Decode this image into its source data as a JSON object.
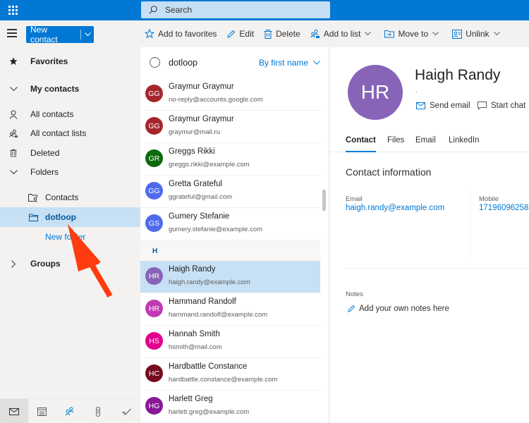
{
  "topbar": {
    "app_launcher_icon": "waffle-icon",
    "search_placeholder": "Search",
    "theme_color": "#0078d4",
    "search_bg": "#c7dff5"
  },
  "commandbar": {
    "new_contact_label": "New contact",
    "actions": [
      {
        "label": "Add to favorites",
        "icon": "star-add-icon",
        "has_dropdown": false
      },
      {
        "label": "Edit",
        "icon": "pencil-icon",
        "has_dropdown": false
      },
      {
        "label": "Delete",
        "icon": "trash-icon",
        "has_dropdown": false
      },
      {
        "label": "Add to list",
        "icon": "add-to-list-icon",
        "has_dropdown": true
      },
      {
        "label": "Move to",
        "icon": "move-to-icon",
        "has_dropdown": true
      },
      {
        "label": "Unlink",
        "icon": "unlink-icon",
        "has_dropdown": true
      }
    ]
  },
  "leftnav": {
    "items": [
      {
        "label": "Favorites",
        "icon": "star-icon"
      },
      {
        "label": "My contacts",
        "icon": "chevron-down-icon"
      },
      {
        "label": "All contacts",
        "icon": "person-icon"
      },
      {
        "label": "All contact lists",
        "icon": "contact-list-icon"
      },
      {
        "label": "Deleted",
        "icon": "trash-icon"
      },
      {
        "label": "Folders",
        "icon": "chevron-down-icon"
      },
      {
        "label": "Contacts",
        "icon": "contact-folder-icon"
      },
      {
        "label": "dotloop",
        "icon": "folder-icon",
        "selected": true
      },
      {
        "label": "New folder",
        "icon": ""
      },
      {
        "label": "Groups",
        "icon": "chevron-right-icon"
      }
    ]
  },
  "appbar": {
    "items": [
      {
        "name": "mail",
        "icon": "mail-icon"
      },
      {
        "name": "calendar",
        "icon": "calendar-icon"
      },
      {
        "name": "people",
        "icon": "people-icon",
        "active": true
      },
      {
        "name": "files",
        "icon": "paperclip-icon"
      },
      {
        "name": "to-do",
        "icon": "checkmark-icon"
      }
    ]
  },
  "list": {
    "folder_name": "dotloop",
    "sort_label": "By first name",
    "section_h": "H",
    "contacts": [
      {
        "initials": "GG",
        "name": "Graymur Graymur",
        "email": "no-reply@accounts.google.com",
        "color": "#a4262c"
      },
      {
        "initials": "GG",
        "name": "Graymur Graymur",
        "email": "graymur@mail.ru",
        "color": "#a4262c"
      },
      {
        "initials": "GR",
        "name": "Greggs Rikki",
        "email": "greggs.rikki@example.com",
        "color": "#0b6a0b"
      },
      {
        "initials": "GG",
        "name": "Gretta Grateful",
        "email": "ggrateful@gmail.com",
        "color": "#4f6bed"
      },
      {
        "initials": "GS",
        "name": "Gumery Stefanie",
        "email": "gumery.stefanie@example.com",
        "color": "#4f6bed"
      },
      {
        "initials": "HR",
        "name": "Haigh Randy",
        "email": "haigh.randy@example.com",
        "color": "#8764b8",
        "selected": true
      },
      {
        "initials": "HR",
        "name": "Hammand Randolf",
        "email": "hammand.randolf@example.com",
        "color": "#c239b3"
      },
      {
        "initials": "HS",
        "name": "Hannah Smith",
        "email": "hsmith@mail.com",
        "color": "#e3008c"
      },
      {
        "initials": "HC",
        "name": "Hardbattle Constance",
        "email": "hardbattle.constance@example.com",
        "color": "#750b1c"
      },
      {
        "initials": "HG",
        "name": "Harlett Greg",
        "email": "harlett.greg@example.com",
        "color": "#881798"
      }
    ]
  },
  "detail": {
    "initials": "HR",
    "avatar_color": "#8764b8",
    "name": "Haigh Randy",
    "subtitle": ".",
    "send_email_label": "Send email",
    "start_chat_label": "Start chat",
    "tabs": [
      "Contact",
      "Files",
      "Email",
      "LinkedIn"
    ],
    "active_tab": "Contact",
    "contact_info_title": "Contact information",
    "email_label": "Email",
    "email_value": "haigh.randy@example.com",
    "mobile_label": "Mobile",
    "mobile_value": "17196096258",
    "notes_label": "Notes",
    "notes_placeholder": "Add your own notes here"
  },
  "annotation": {
    "arrow_color": "#ff3b0f",
    "points_to": "dotloop"
  }
}
